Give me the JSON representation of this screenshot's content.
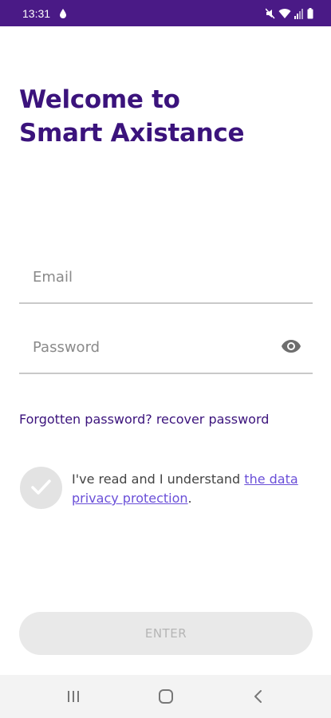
{
  "status_bar": {
    "time": "13:31",
    "background_color": "#4a1a86"
  },
  "title": {
    "line1": "Welcome to",
    "line2": "Smart Axistance",
    "color": "#3b137c"
  },
  "form": {
    "email_placeholder": "Email",
    "email_value": "",
    "password_placeholder": "Password",
    "password_value": "",
    "password_visibility_icon": "eye-icon"
  },
  "forgot_password": {
    "prefix": "Forgotten password?",
    "link": "recover password"
  },
  "consent": {
    "checked": false,
    "text": "I've read and I understand",
    "link": "the data privacy protection",
    "suffix": "."
  },
  "enter_button": {
    "label": "ENTER",
    "enabled": false
  },
  "navigation_bar": {
    "icons": [
      "recents-icon",
      "home-icon",
      "back-icon"
    ]
  },
  "colors": {
    "accent": "#3b137c",
    "link": "#6a4fd8",
    "disabled": "#e9e9e9"
  }
}
